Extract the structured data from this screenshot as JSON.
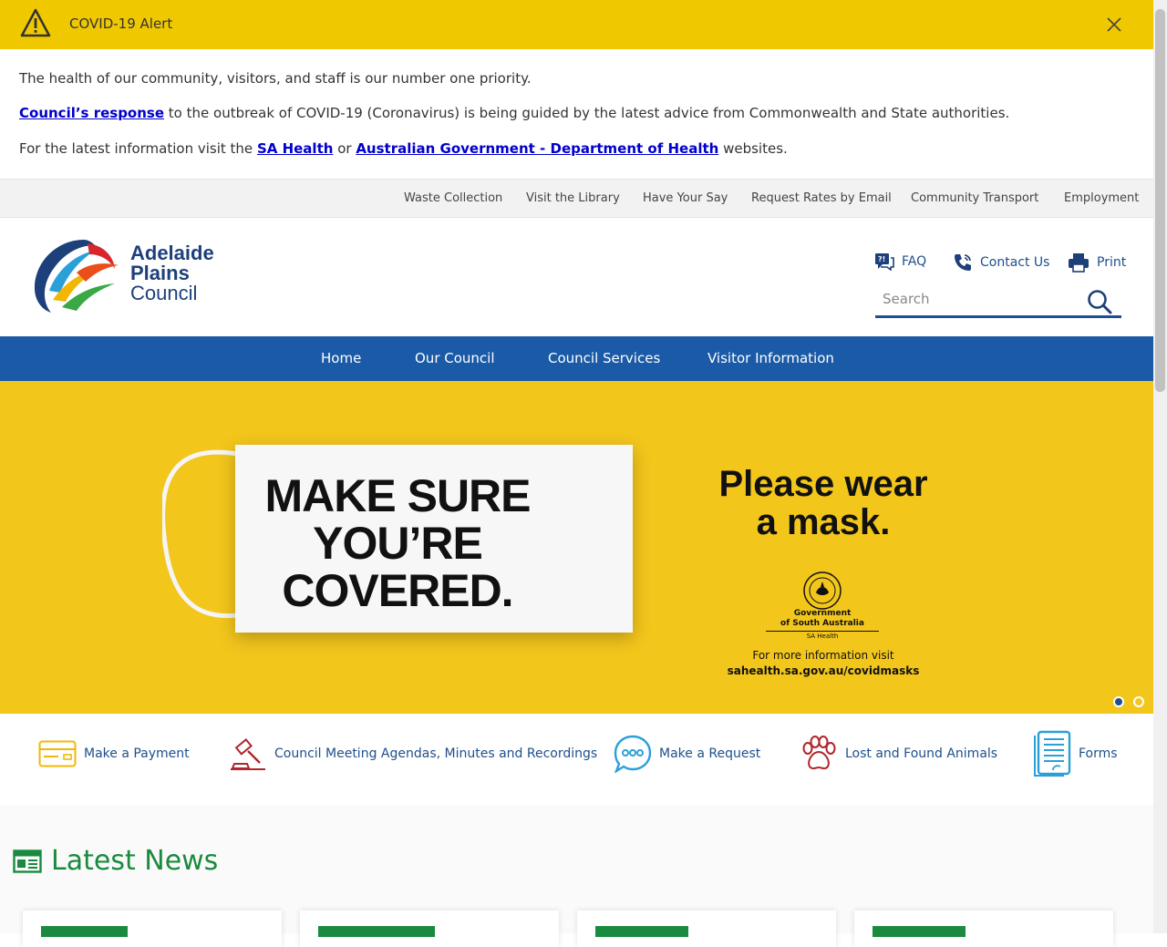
{
  "alert": {
    "title": "COVID-19 Alert",
    "line1": "The health of our community, visitors, and staff is our number one priority.",
    "line2_link": "Council’s response",
    "line2_rest": " to the outbreak of COVID-19 (Coronavirus) is being guided by the latest advice from Commonwealth and State authorities.",
    "line3_pre": "For the latest information visit the ",
    "line3_link1": "SA Health",
    "line3_mid": " or ",
    "line3_link2": "Australian Government - Department of Health",
    "line3_post": " websites.",
    "accent": "#f0c800"
  },
  "utility_nav": [
    "Waste Collection",
    "Visit the Library",
    "Have Your Say",
    "Request Rates by Email",
    "Community Transport",
    "Employment"
  ],
  "header": {
    "logo_line1": "Adelaide",
    "logo_line2": "Plains",
    "logo_line3": "Council",
    "faq": "FAQ",
    "contact": "Contact Us",
    "print": "Print",
    "search_placeholder": "Search"
  },
  "main_nav": [
    "Home",
    "Our Council",
    "Council Services",
    "Visitor Information"
  ],
  "hero": {
    "mask_line1": "MAKE SURE",
    "mask_line2": "YOU’RE",
    "mask_line3": "COVERED.",
    "wear_line1": "Please wear",
    "wear_line2": "a mask.",
    "gov_line1": "Government",
    "gov_line2": "of South Australia",
    "gov_sub": "SA Health",
    "more_info": "For more information visit",
    "more_url": "sahealth.sa.gov.au/covidmasks",
    "background": "#f3c61c"
  },
  "quick_links": [
    "Make a Payment",
    "Council Meeting Agendas, Minutes and Recordings",
    "Make a Request",
    "Lost and Found Animals",
    "Forms"
  ],
  "news": {
    "title": "Latest News",
    "accent": "#1a8a3e"
  },
  "colors": {
    "nav_blue": "#1b5aa6",
    "link_blue": "#1d4f8c"
  }
}
